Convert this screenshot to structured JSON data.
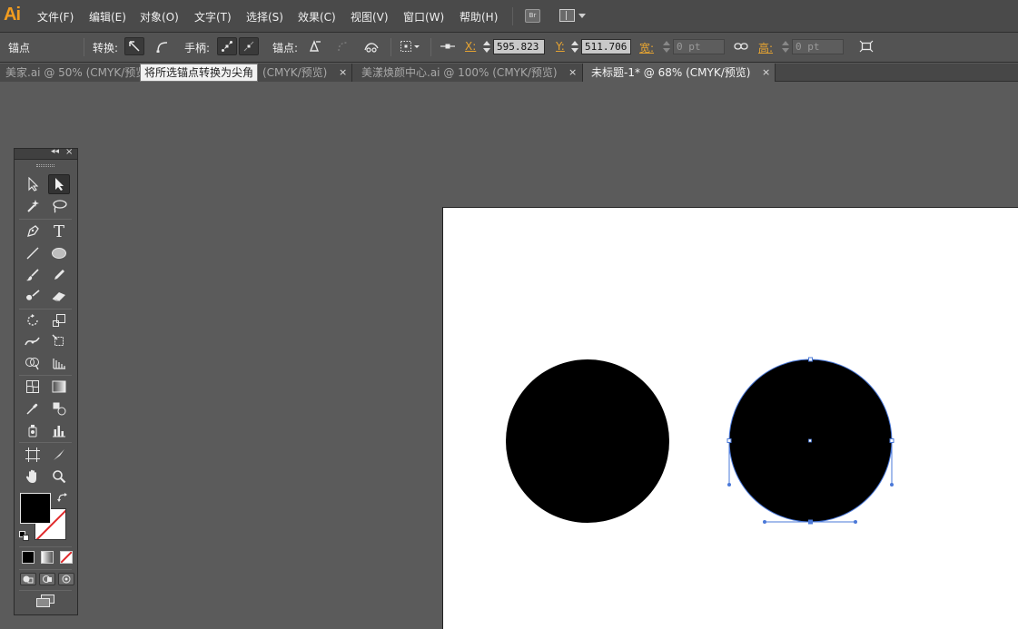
{
  "app": {
    "logo": "Ai"
  },
  "menu": {
    "items": [
      "文件(F)",
      "编辑(E)",
      "对象(O)",
      "文字(T)",
      "选择(S)",
      "效果(C)",
      "视图(V)",
      "窗口(W)",
      "帮助(H)"
    ],
    "bridge_label": "Br"
  },
  "controlbar": {
    "mode_label": "锚点",
    "convert_label": "转换:",
    "handles_label": "手柄:",
    "anchor_label": "锚点:",
    "x_label": "X:",
    "x_value": "595.823",
    "y_label": "Y:",
    "y_value": "511.706",
    "w_label": "宽:",
    "w_value": "0 pt",
    "h_label": "高:",
    "h_value": "0 pt",
    "unit_sep": ":"
  },
  "tabs": [
    {
      "label": "美家.ai @ 50% (CMYK/预览)",
      "active": false
    },
    {
      "label": "(CMYK/预览)",
      "active": false
    },
    {
      "label": "美漾焕颜中心.ai @ 100% (CMYK/预览)",
      "active": false
    },
    {
      "label": "未标题-1* @ 68% (CMYK/预览)",
      "active": true
    }
  ],
  "tab_close_glyph": "×",
  "tooltip": "将所选锚点转换为尖角",
  "toolpanel": {
    "collapse_glyph": "◂◂",
    "close_glyph": "×",
    "text_tool_glyph": "T"
  },
  "colors": {
    "accent_orange": "#f29c1f",
    "selection_blue": "#4a78d8",
    "fill": "#000000",
    "stroke": "#ffffff",
    "none_red": "#e0282a"
  }
}
